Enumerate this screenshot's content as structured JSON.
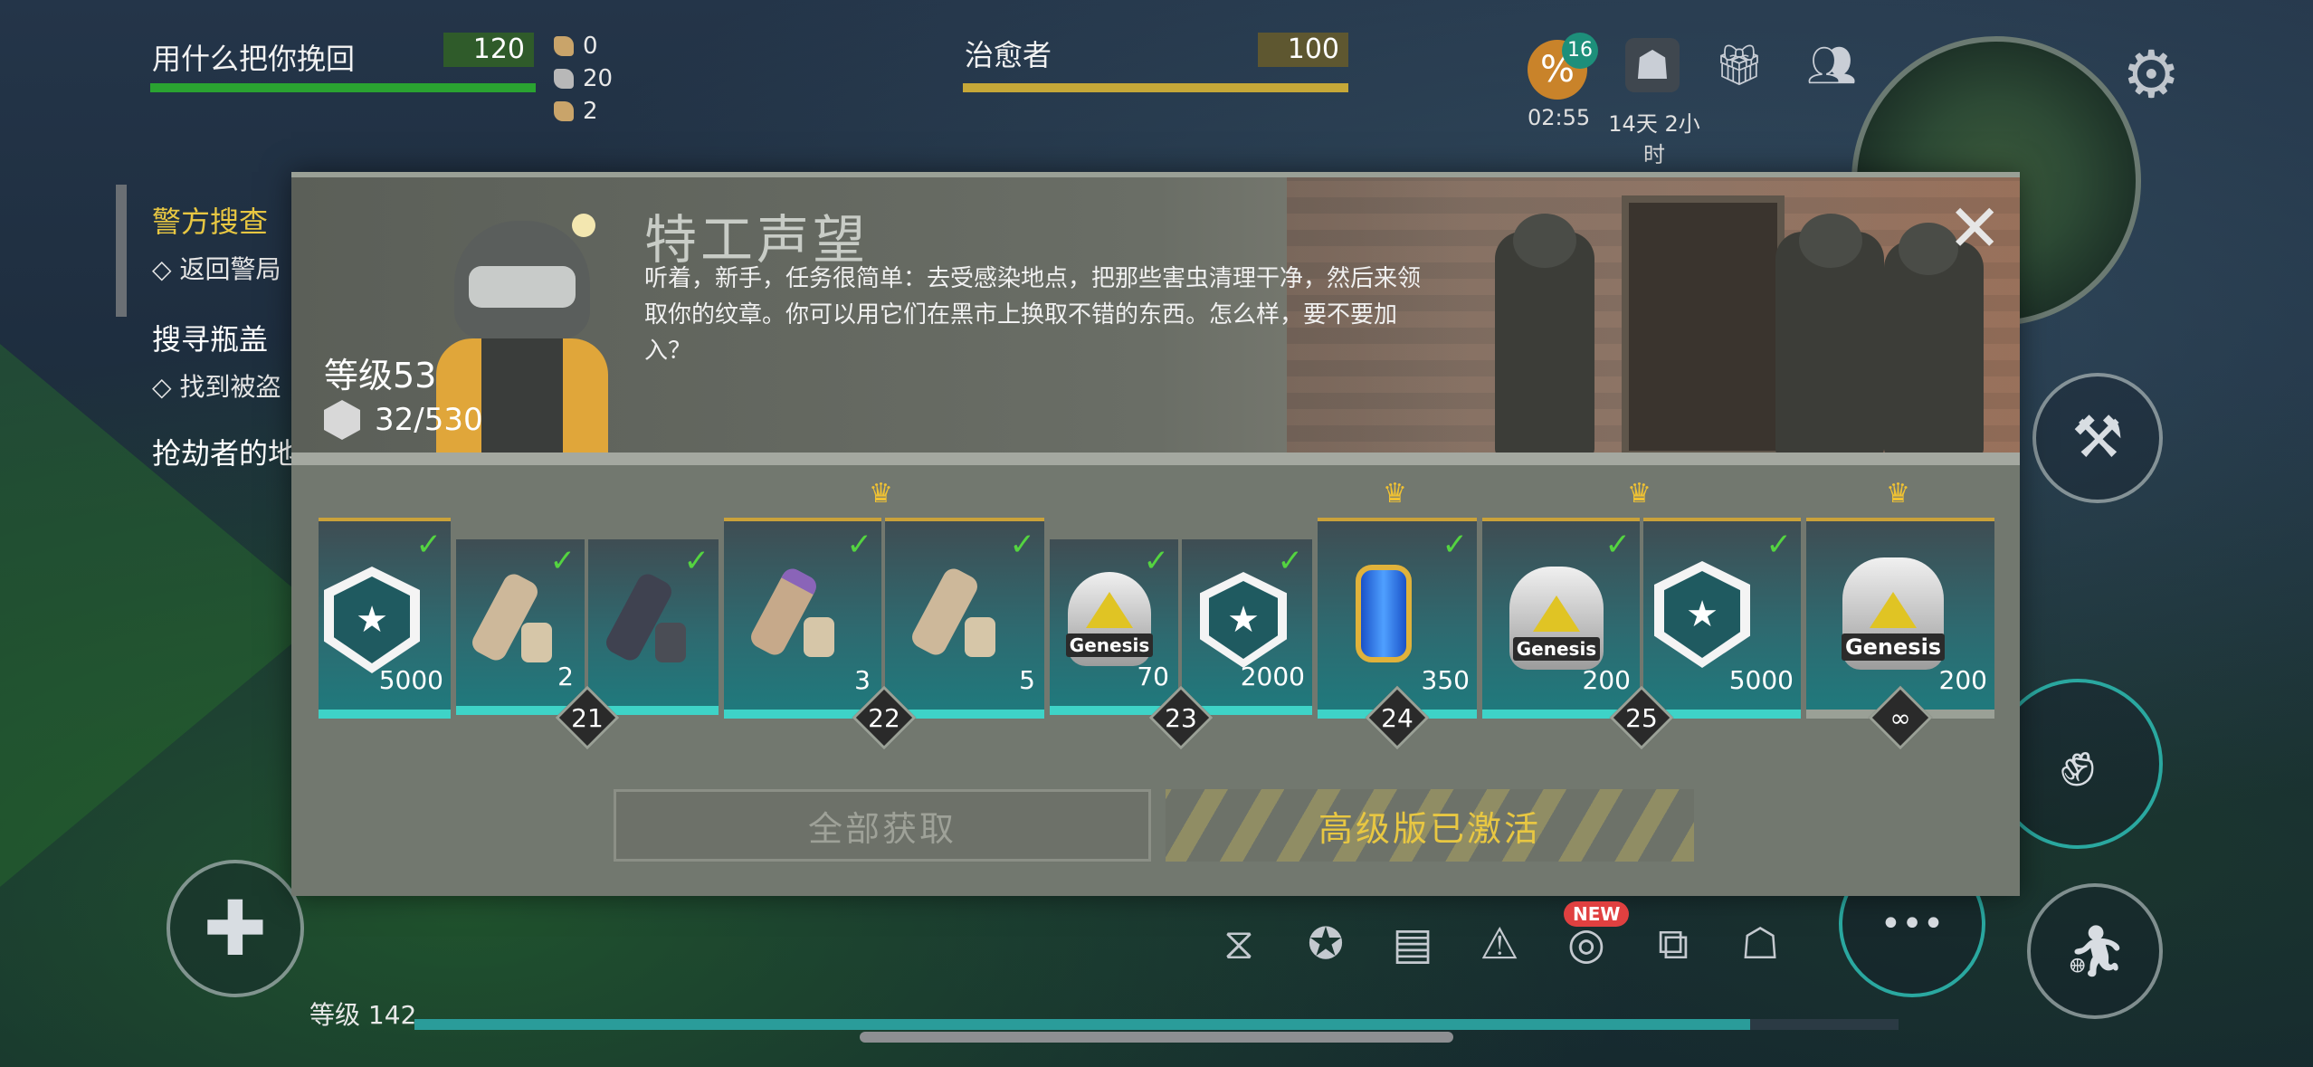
{
  "hud": {
    "player_name": "用什么把你挽回",
    "player_value": "120",
    "partner_name": "治愈者",
    "partner_value": "100",
    "resources": [
      {
        "icon": "bullet-icon",
        "value": "0"
      },
      {
        "icon": "fly-icon",
        "value": "20"
      },
      {
        "icon": "shell-icon",
        "value": "2"
      }
    ],
    "sale_badge": "16",
    "sale_timer": "02:55",
    "event_timer": "14天 2小时",
    "colors": {
      "player_bar": "#2aa331",
      "partner_bar": "#c6a838",
      "player_val_bg": "#2f5b2a",
      "partner_val_bg": "#5e5730"
    }
  },
  "quests": {
    "items": [
      {
        "title": "警方搜查",
        "sub": "返回警局"
      },
      {
        "title": "搜寻瓶盖",
        "sub": "找到被盗"
      },
      {
        "title": "抢劫者的地",
        "sub": ""
      }
    ]
  },
  "modal": {
    "title": "特工声望",
    "description": "听着，新手，任务很简单：去受感染地点，把那些害虫清理干净，然后来领取你的纹章。你可以用它们在黑市上换取不错的东西。怎么样，要不要加入？",
    "level_label": "等级53",
    "xp": "32/530",
    "close": "✕",
    "tiers": [
      {
        "badge": "",
        "crown": false,
        "rewards": [
          {
            "type": "shield",
            "amount": "5000"
          }
        ]
      },
      {
        "badge": "21",
        "crown": false,
        "rewards": [
          {
            "type": "bag-tan",
            "amount": "2"
          },
          {
            "type": "bag-dark",
            "amount": ""
          }
        ]
      },
      {
        "badge": "22",
        "crown": true,
        "rewards": [
          {
            "type": "bag-purple",
            "amount": "3"
          },
          {
            "type": "bag-tan",
            "amount": "5"
          }
        ]
      },
      {
        "badge": "23",
        "crown": false,
        "rewards": [
          {
            "type": "genesis",
            "amount": "70"
          },
          {
            "type": "shield",
            "amount": "2000"
          }
        ]
      },
      {
        "badge": "24",
        "crown": true,
        "rewards": [
          {
            "type": "capsule",
            "amount": "350"
          }
        ]
      },
      {
        "badge": "25",
        "crown": true,
        "rewards": [
          {
            "type": "genesis",
            "amount": "200"
          },
          {
            "type": "shield",
            "amount": "5000"
          }
        ]
      },
      {
        "badge": "∞",
        "crown": true,
        "rewards": [
          {
            "type": "genesis",
            "amount": "200"
          }
        ]
      }
    ],
    "claim_all": "全部获取",
    "premium_status": "高级版已激活"
  },
  "bottom": {
    "level_label": "等级 142",
    "xp_progress": 0.9,
    "new_badge": "NEW",
    "toolbar_icons": [
      "dna-icon",
      "shield-star-icon",
      "clipboard-icon",
      "alert-icon",
      "coins-icon",
      "map-icon",
      "backpack-icon"
    ]
  }
}
